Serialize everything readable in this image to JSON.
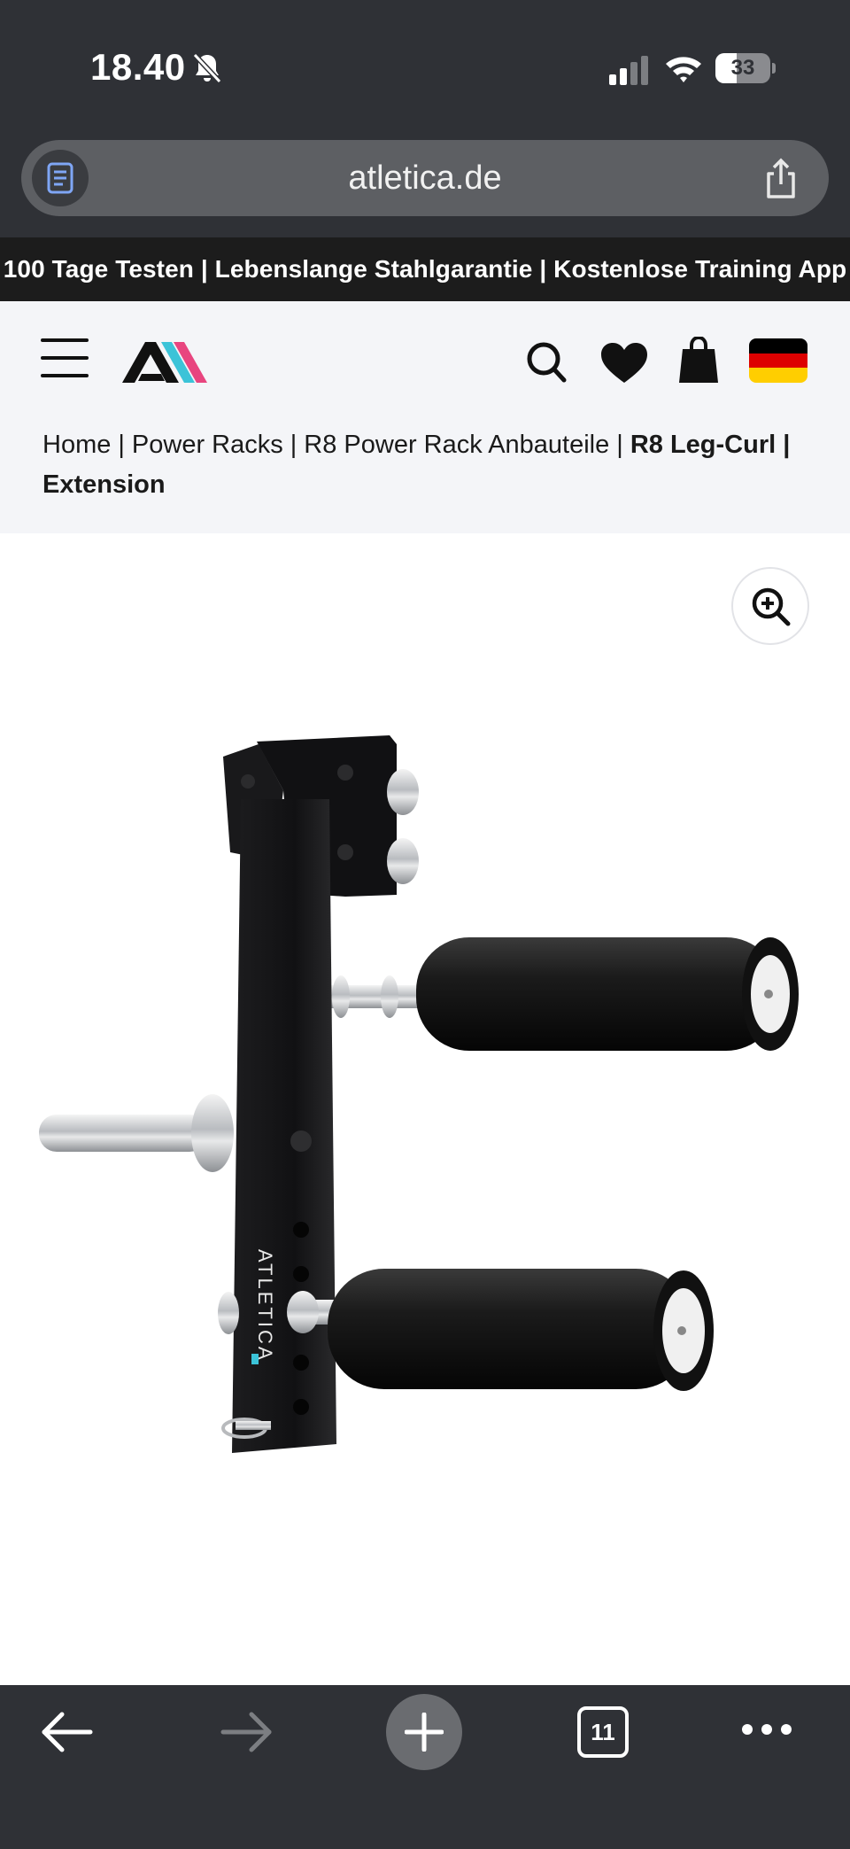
{
  "status_bar": {
    "time": "18.40",
    "battery_level": "33",
    "icons": [
      "bell-slash-icon",
      "cellular-signal-icon",
      "wifi-icon",
      "battery-icon"
    ]
  },
  "browser": {
    "url": "atletica.de",
    "tab_count": "11",
    "icons": [
      "reader-icon",
      "share-icon",
      "back-arrow-icon",
      "forward-arrow-icon",
      "plus-icon",
      "tabs-icon",
      "more-icon"
    ]
  },
  "promo_bar": {
    "text": "100 Tage Testen | Lebenslange Stahlgarantie | Kostenlose Training App"
  },
  "header": {
    "icons": [
      "menu-icon",
      "atletica-logo",
      "search-icon",
      "heart-icon",
      "shopping-bag-icon",
      "germany-flag-icon"
    ],
    "flag_colors": [
      "#000000",
      "#dd0000",
      "#ffce00"
    ]
  },
  "breadcrumb": {
    "items": [
      "Home",
      "Power Racks",
      "R8 Power Rack Anbauteile"
    ],
    "current": "R8 Leg-Curl | Extension",
    "separator": "|"
  },
  "product": {
    "zoom_icon": "zoom-in-icon",
    "image_alt_brand": "ATLETICA"
  },
  "colors": {
    "chrome": "#2f3136",
    "promo_bg": "#1c1c1c",
    "header_bg": "#f4f5f8",
    "logo_cyan": "#3bc3d8",
    "logo_pink": "#e8457f"
  }
}
